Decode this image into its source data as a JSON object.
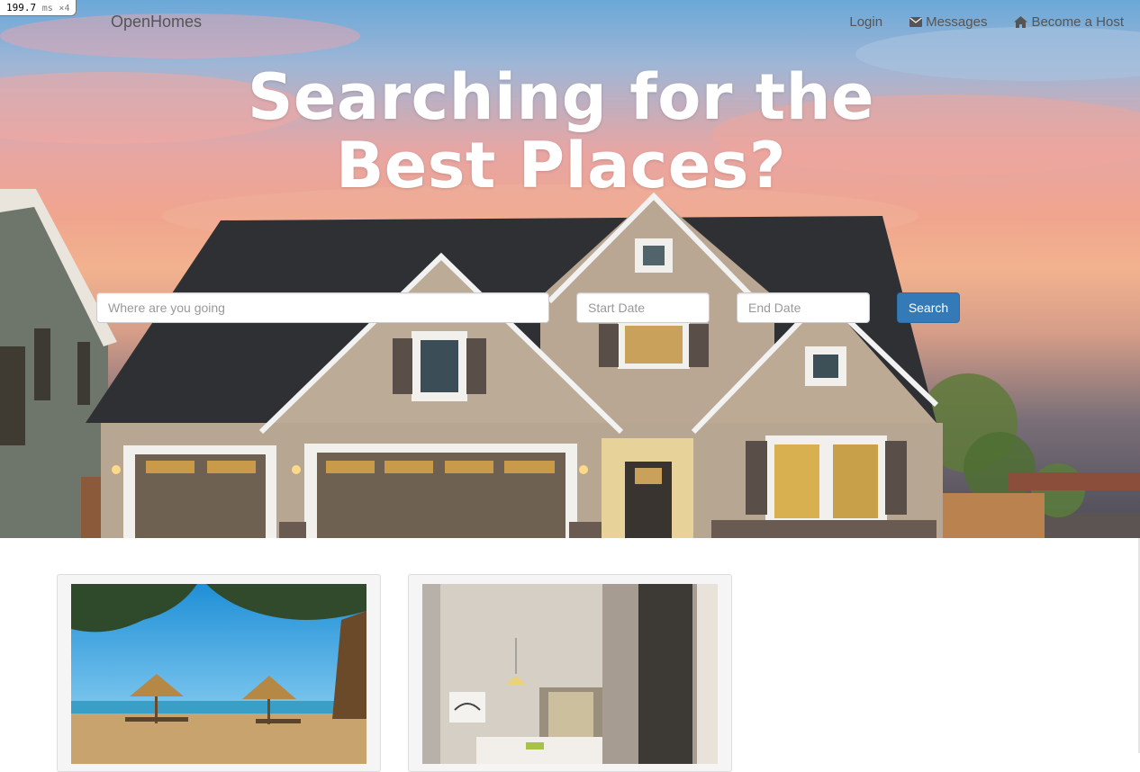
{
  "perf": {
    "value": "199.7",
    "unit": "ms",
    "multiplier": "×4"
  },
  "nav": {
    "brand": "OpenHomes",
    "links": [
      {
        "label": "Login",
        "icon": ""
      },
      {
        "label": "Messages",
        "icon": "envelope-icon"
      },
      {
        "label": "Become a Host",
        "icon": "home-icon"
      }
    ]
  },
  "hero": {
    "headline_line1": "Searching for the",
    "headline_line2": "Best Places?"
  },
  "search": {
    "where_placeholder": "Where are you going",
    "start_placeholder": "Start Date",
    "end_placeholder": "End Date",
    "button_label": "Search"
  },
  "colors": {
    "primary_button": "#337ab7",
    "nav_text": "#555555",
    "headline": "#ffffff"
  },
  "listings": [
    {
      "image": "beach-umbrellas-photo"
    },
    {
      "image": "hotel-bedroom-photo"
    }
  ]
}
